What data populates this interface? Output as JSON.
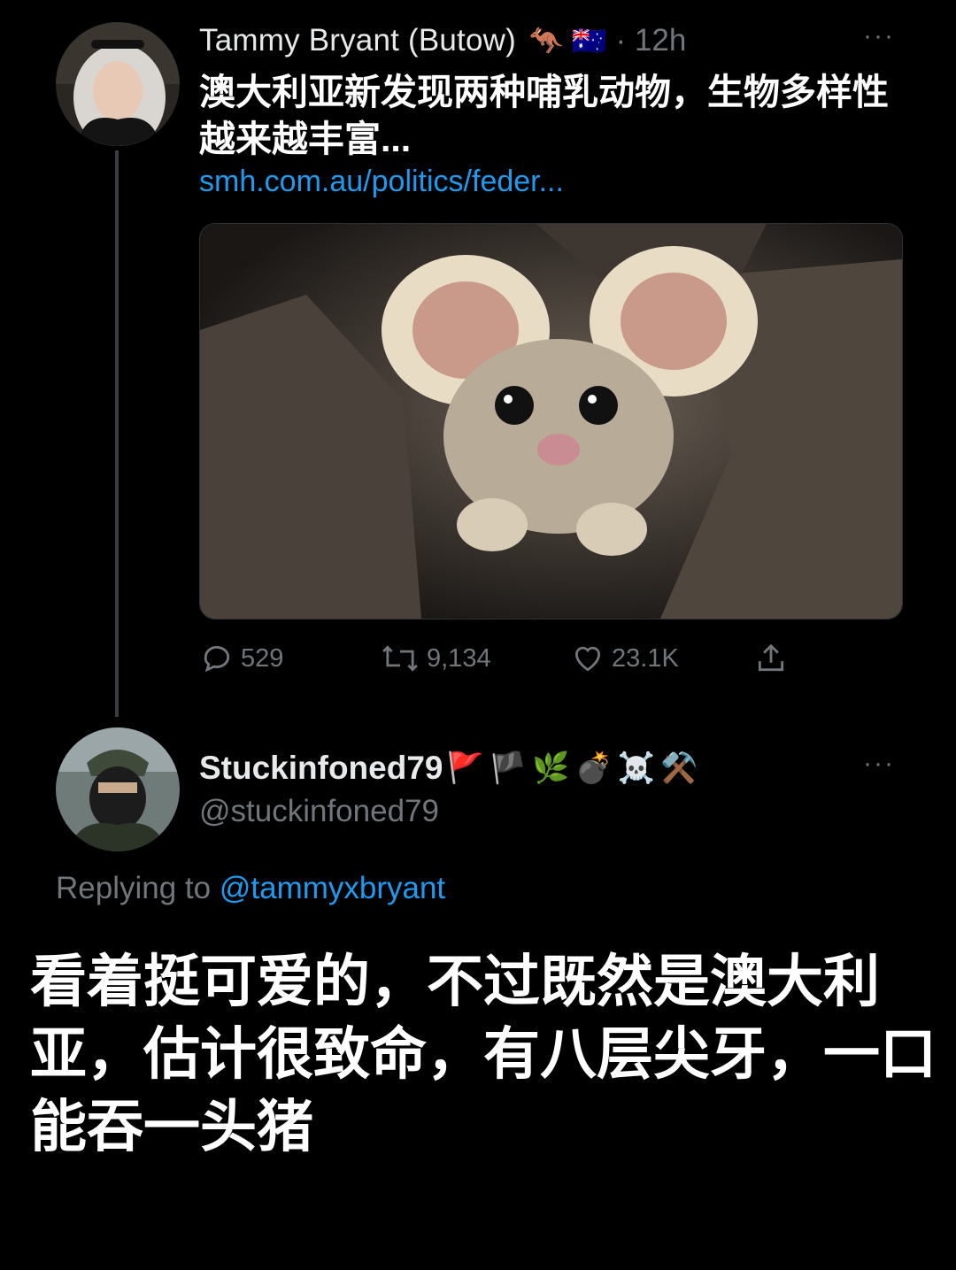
{
  "tweet": {
    "author_name": "Tammy Bryant (Butow)",
    "author_emojis": "🦘 🇦🇺",
    "timestamp": "· 12h",
    "more_label": "···",
    "text": "澳大利亚新发现两种哺乳动物，生物多样性越来越丰富...",
    "link": "smh.com.au/politics/feder...",
    "stats": {
      "replies": "529",
      "retweets": "9,134",
      "likes": "23.1K"
    }
  },
  "reply": {
    "author_name": "Stuckinfoned79",
    "author_emojis": "🚩🏴🌿💣☠️⚒️",
    "handle": "@stuckinfoned79",
    "more_label": "···",
    "replying_prefix": "Replying to",
    "replying_to": "@tammyxbryant"
  },
  "caption": "看着挺可爱的，不过既然是澳大利亚，估计很致命，有八层尖牙，一口能吞一头猪",
  "colors": {
    "background": "#000000",
    "link": "#1d9bf0",
    "muted": "#71767b",
    "thread_line": "#3a3d41"
  },
  "icons": [
    "more-icon",
    "reply-icon",
    "retweet-icon",
    "like-icon",
    "share-icon"
  ]
}
